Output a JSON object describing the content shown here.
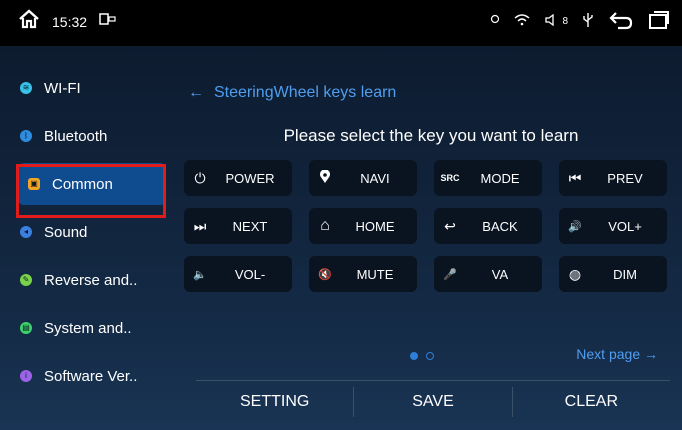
{
  "status": {
    "time": "15:32",
    "battery_level": "8",
    "icons": [
      "home-icon",
      "usb-icon",
      "location-icon",
      "wifi-icon",
      "speaker-icon",
      "usb-icon",
      "back-icon",
      "recent-apps-icon"
    ]
  },
  "sidebar": {
    "items": [
      {
        "label": "WI-FI",
        "color": "#37c3e8"
      },
      {
        "label": "Bluetooth",
        "color": "#2f8de0"
      },
      {
        "label": "Common",
        "color": "#f1a321"
      },
      {
        "label": "Sound",
        "color": "#3b7fe0"
      },
      {
        "label": "Reverse and..",
        "color": "#78d34b"
      },
      {
        "label": "System and..",
        "color": "#3fd16a"
      },
      {
        "label": "Software Ver..",
        "color": "#9b63e8"
      }
    ],
    "active_index": 2
  },
  "content": {
    "title": "SteeringWheel keys learn",
    "prompt": "Please select the key you want to learn",
    "keys": [
      {
        "icon": "⏻",
        "label": "POWER",
        "icon_name": "power-icon"
      },
      {
        "icon": "⬤",
        "label": "NAVI",
        "icon_name": "location-pin-icon"
      },
      {
        "icon": "SRC",
        "label": "MODE",
        "icon_name": "source-icon"
      },
      {
        "icon": "⏮",
        "label": "PREV",
        "icon_name": "previous-track-icon"
      },
      {
        "icon": "⏭",
        "label": "NEXT",
        "icon_name": "next-track-icon"
      },
      {
        "icon": "⌂",
        "label": "HOME",
        "icon_name": "home-icon"
      },
      {
        "icon": "↩",
        "label": "BACK",
        "icon_name": "back-icon"
      },
      {
        "icon": "🔊",
        "label": "VOL+",
        "icon_name": "volume-up-icon"
      },
      {
        "icon": "🔈",
        "label": "VOL-",
        "icon_name": "volume-down-icon"
      },
      {
        "icon": "🔇",
        "label": "MUTE",
        "icon_name": "mute-icon"
      },
      {
        "icon": "🎤",
        "label": "VA",
        "icon_name": "microphone-icon"
      },
      {
        "icon": "◍",
        "label": "DIM",
        "icon_name": "dim-icon"
      }
    ],
    "next_page": "Next page",
    "page_count": 2,
    "current_page": 1
  },
  "bottom": {
    "setting": "SETTING",
    "save": "SAVE",
    "clear": "CLEAR"
  }
}
